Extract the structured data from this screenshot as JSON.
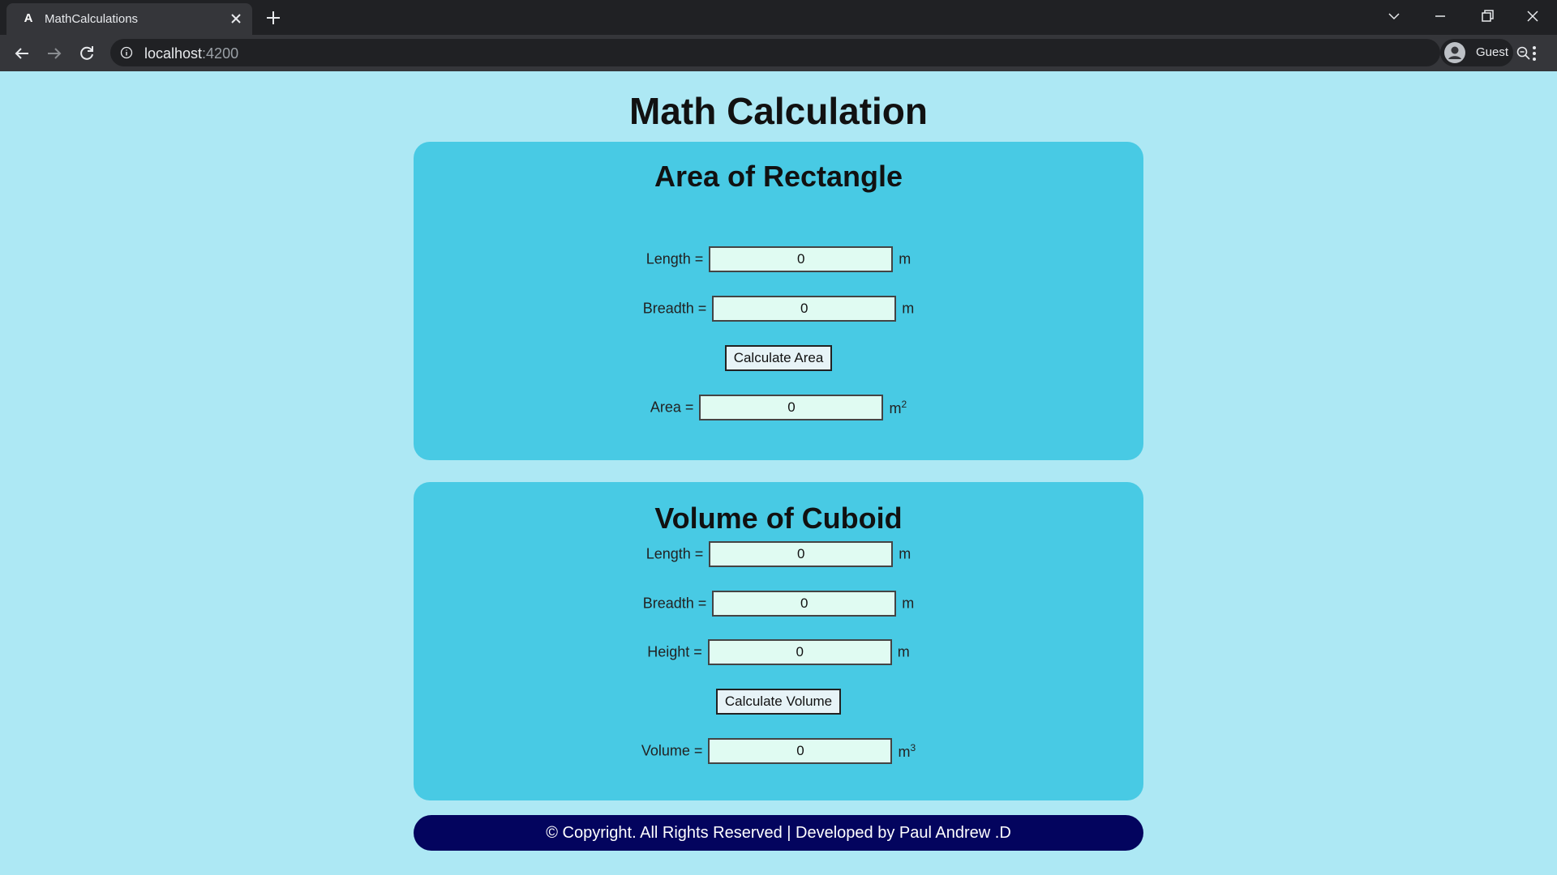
{
  "browser": {
    "tab_title": "MathCalculations",
    "url_host": "localhost",
    "url_port": ":4200",
    "profile_name": "Guest"
  },
  "page": {
    "title": "Math Calculation"
  },
  "area_card": {
    "title": "Area of Rectangle",
    "length_label": "Length =",
    "length_value": "0",
    "length_unit": "m",
    "breadth_label": "Breadth =",
    "breadth_value": "0",
    "breadth_unit": "m",
    "button_label": "Calculate Area",
    "result_label": "Area =",
    "result_value": "0",
    "result_unit": "m",
    "result_unit_sup": "2"
  },
  "volume_card": {
    "title": "Volume of Cuboid",
    "length_label": "Length =",
    "length_value": "0",
    "length_unit": "m",
    "breadth_label": "Breadth =",
    "breadth_value": "0",
    "breadth_unit": "m",
    "height_label": "Height =",
    "height_value": "0",
    "height_unit": "m",
    "button_label": "Calculate Volume",
    "result_label": "Volume =",
    "result_value": "0",
    "result_unit": "m",
    "result_unit_sup": "3"
  },
  "footer": {
    "text": "© Copyright. All Rights Reserved | Developed by Paul Andrew .D"
  }
}
